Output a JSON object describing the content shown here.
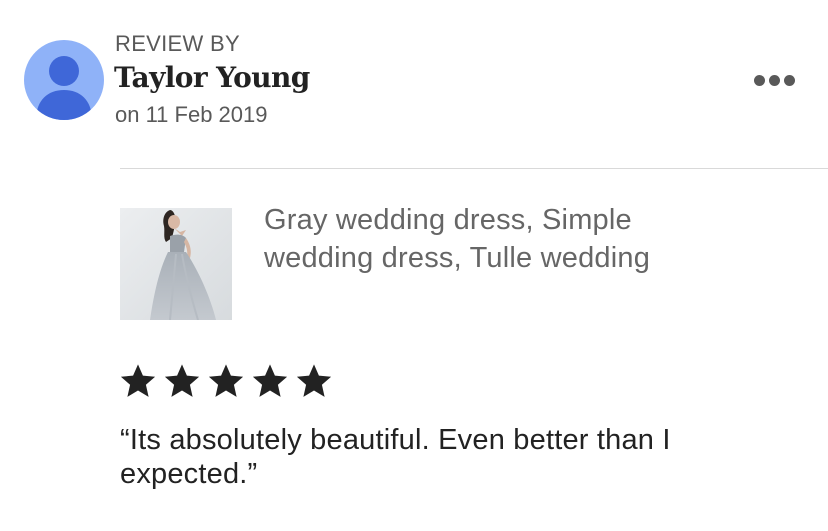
{
  "review": {
    "header_label": "REVIEW BY",
    "reviewer_name": "Taylor Young",
    "date": "on 11 Feb 2019",
    "avatar_icon": "user-silhouette-icon",
    "more_icon": "more-options-icon",
    "product": {
      "title": "Gray wedding dress, Simple wedding dress, Tulle wedding"
    },
    "rating": 5,
    "rating_max": 5,
    "text": "“Its absolutely beautiful. Even better than I expected.”"
  },
  "colors": {
    "avatar_bg": "#8fb2f8",
    "avatar_figure": "#3f67d8",
    "star": "#222222",
    "muted_text": "#595959",
    "divider": "#d9d9d9"
  }
}
